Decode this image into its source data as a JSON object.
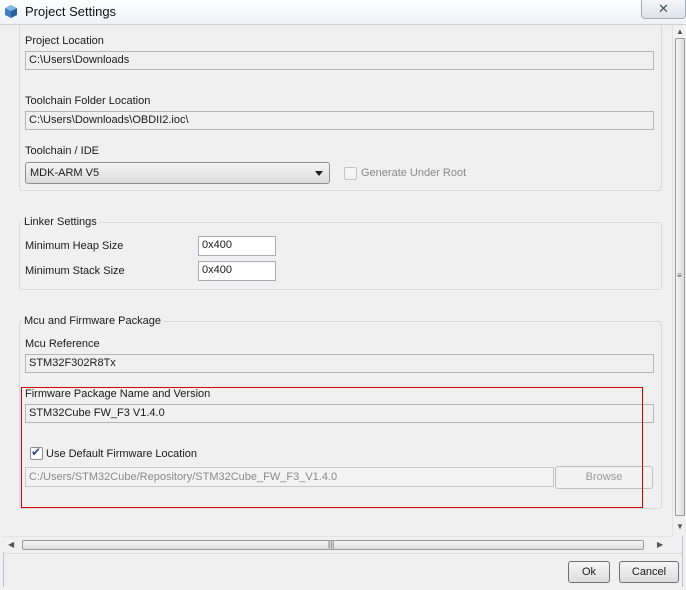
{
  "window": {
    "title": "Project Settings",
    "close_glyph": "✕",
    "icon": "app-cube-icon"
  },
  "project": {
    "location_label": "Project Location",
    "location_value": "C:\\Users\\Downloads",
    "toolchain_folder_label": "Toolchain Folder Location",
    "toolchain_folder_value": "C:\\Users\\Downloads\\OBDII2.ioc\\",
    "toolchain_ide_label": "Toolchain / IDE",
    "toolchain_ide_selected": "MDK-ARM V5",
    "generate_under_root_label": "Generate Under Root"
  },
  "linker": {
    "legend": "Linker Settings",
    "heap_label": "Minimum Heap Size",
    "heap_value": "0x400",
    "stack_label": "Minimum Stack Size",
    "stack_value": "0x400"
  },
  "mcu": {
    "legend": "Mcu and Firmware Package",
    "reference_label": "Mcu Reference",
    "reference_value": "STM32F302R8Tx",
    "fw_name_label": "Firmware Package Name and Version",
    "fw_name_value": "STM32Cube FW_F3 V1.4.0",
    "use_default_label": "Use Default Firmware Location",
    "use_default_checked": true,
    "fw_location_value": "C:/Users/STM32Cube/Repository/STM32Cube_FW_F3_V1.4.0",
    "browse_label": "Browse"
  },
  "footer": {
    "ok_label": "Ok",
    "cancel_label": "Cancel"
  },
  "colors": {
    "highlight": "#d40000",
    "accent": "#2a4d8f"
  }
}
